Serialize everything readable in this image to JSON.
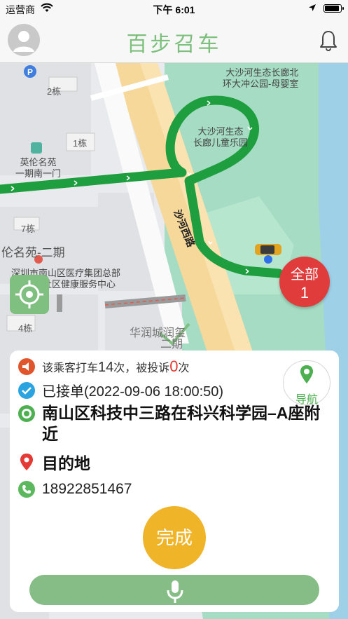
{
  "status_bar": {
    "carrier": "运营商",
    "time": "下午 6:01"
  },
  "nav": {
    "title": "百步召车"
  },
  "map": {
    "labels": {
      "building_2": "2栋",
      "building_1": "1栋",
      "building_7": "7栋",
      "building_4": "4栋",
      "yingluncomplex": "英伦名苑",
      "yingluncomplex_gate": "一期南一门",
      "yingluncomplex2": "伦名苑-二期",
      "road": "沙河西路",
      "park1_line1": "大沙河生态长廊北",
      "park1_line2": "环大冲公园-母婴室",
      "park2_line1": "大沙河生态",
      "park2_line2": "长廊儿童乐园",
      "hospital_line1": "深圳市南山区医疗集团总部",
      "hospital_line2": "社区健康服务中心",
      "huarun_line1": "华润城润玺",
      "huarun_line2": "二期"
    },
    "all_button": {
      "label": "全部",
      "count": "1"
    }
  },
  "card": {
    "complaint": {
      "prefix": "该乘客打车",
      "rides": "14",
      "middle": "次，被投诉",
      "complaints": "0",
      "suffix": "次"
    },
    "accepted": "已接单(2022-09-06 18:00:50)",
    "origin": "南山区科技中三路在科兴科学园–A座附近",
    "destination": "目的地",
    "phone": "18922851467",
    "nav_button": "导航",
    "done_button": "完成"
  },
  "colors": {
    "brand_green": "#7dbf7d",
    "route_green": "#1e9e3e",
    "alert_red": "#e03c3c",
    "done_yellow": "#f0b429"
  },
  "icons": [
    "wifi-icon",
    "location-arrow-icon",
    "battery-icon",
    "avatar-icon",
    "bell-icon",
    "locate-target-icon",
    "megaphone-icon",
    "check-icon",
    "origin-dot-icon",
    "destination-pin-icon",
    "phone-icon",
    "navigation-pin-icon",
    "microphone-icon",
    "taxi-icon"
  ]
}
